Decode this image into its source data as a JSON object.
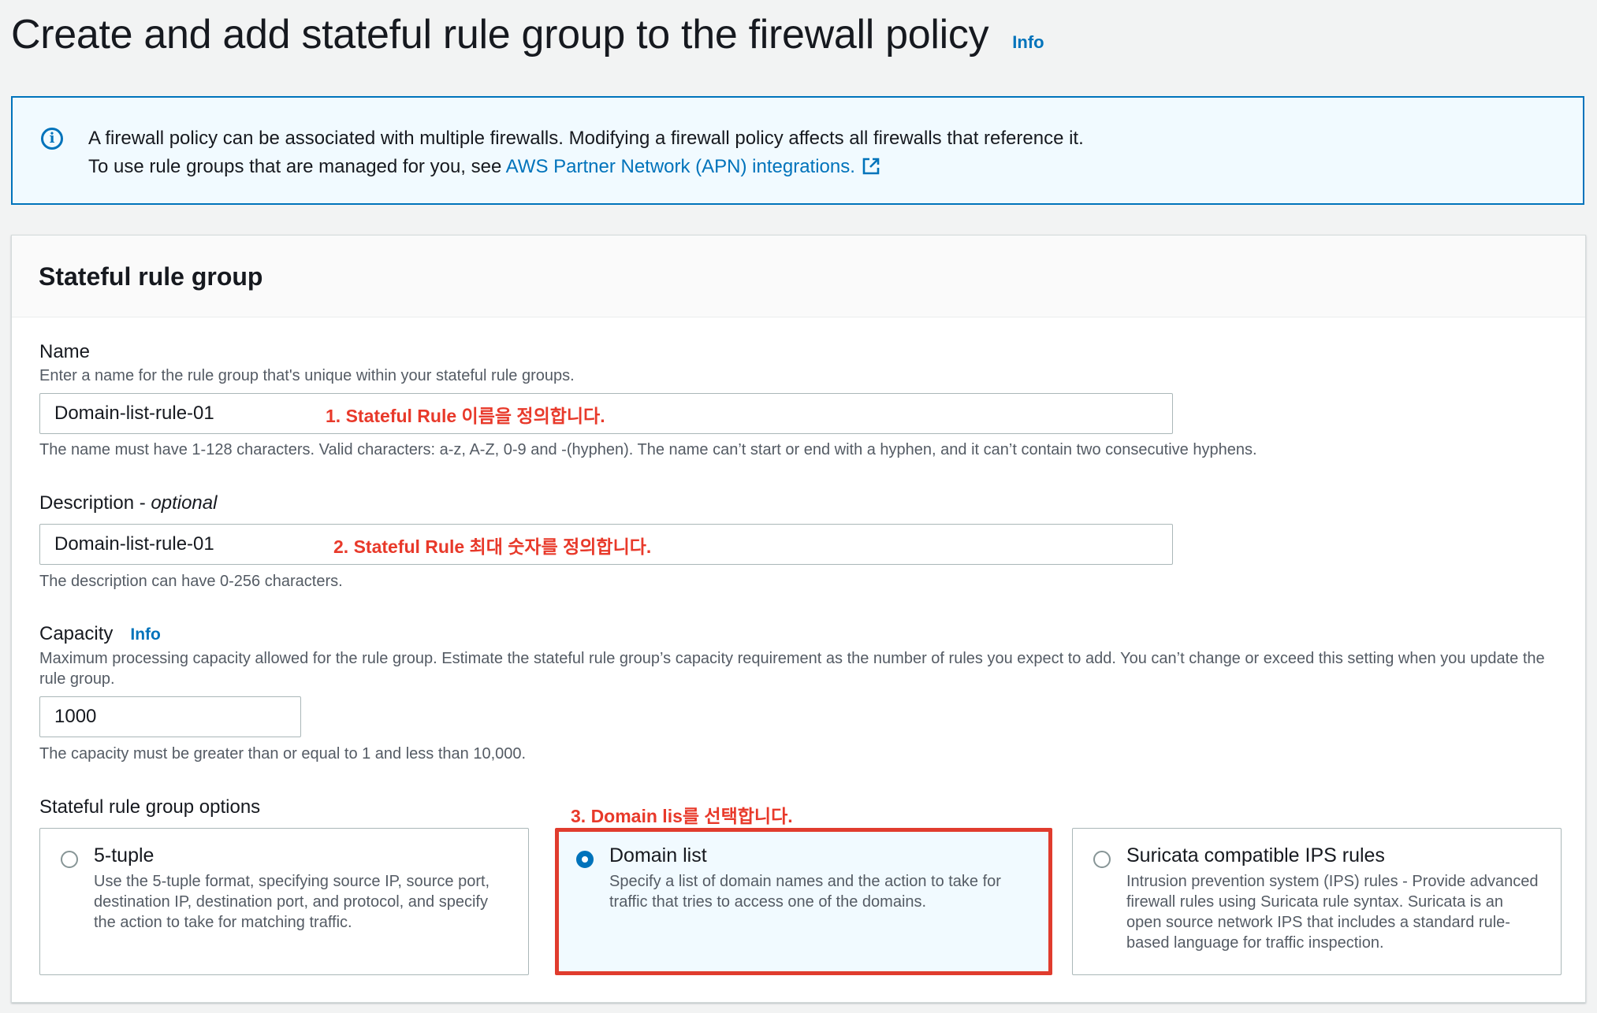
{
  "header": {
    "title": "Create and add stateful rule group to the firewall policy",
    "info": "Info"
  },
  "alert": {
    "line1": "A firewall policy can be associated with multiple firewalls. Modifying a firewall policy affects all firewalls that reference it.",
    "line2_prefix": "To use rule groups that are managed for you, see ",
    "link": "AWS Partner Network (APN) integrations."
  },
  "container": {
    "title": "Stateful rule group",
    "name": {
      "label": "Name",
      "description": "Enter a name for the rule group that's unique within your stateful rule groups.",
      "value": "Domain-list-rule-01",
      "constraint": "The name must have 1-128 characters. Valid characters: a-z, A-Z, 0-9 and -(hyphen). The name can’t start or end with a hyphen, and it can’t contain two consecutive hyphens."
    },
    "description_field": {
      "label": "Description - ",
      "label_optional": "optional",
      "value": "Domain-list-rule-01",
      "constraint": "The description can have 0-256 characters."
    },
    "capacity": {
      "label": "Capacity",
      "info": "Info",
      "description": "Maximum processing capacity allowed for the rule group. Estimate the stateful rule group’s capacity requirement as the number of rules you expect to add. You can’t change or exceed this setting when you update the rule group.",
      "value": "1000",
      "constraint": "The capacity must be greater than or equal to 1 and less than 10,000."
    },
    "options": {
      "label": "Stateful rule group options",
      "tiles": [
        {
          "title": "5-tuple",
          "description": "Use the 5-tuple format, specifying source IP, source port, destination IP, destination port, and protocol, and specify the action to take for matching traffic.",
          "selected": false
        },
        {
          "title": "Domain list",
          "description": "Specify a list of domain names and the action to take for traffic that tries to access one of the domains.",
          "selected": true
        },
        {
          "title": "Suricata compatible IPS rules",
          "description": "Intrusion prevention system (IPS) rules - Provide advanced firewall rules using Suricata rule syntax. Suricata is an open source network IPS that includes a standard rule-based language for traffic inspection.",
          "selected": false
        }
      ]
    }
  },
  "annotations": {
    "a1": "1. Stateful Rule 이름을 정의합니다.",
    "a2": "2. Stateful Rule 최대 숫자를 정의합니다.",
    "a3": "3. Domain lis를 선택합니다."
  },
  "colors": {
    "accent": "#0073bb",
    "annotation": "#e8392a",
    "background": "#f2f3f3"
  },
  "icons": {
    "info": "info-circle-icon",
    "external": "external-link-icon",
    "radio_selected": "radio-selected-icon",
    "radio_unselected": "radio-unselected-icon"
  }
}
